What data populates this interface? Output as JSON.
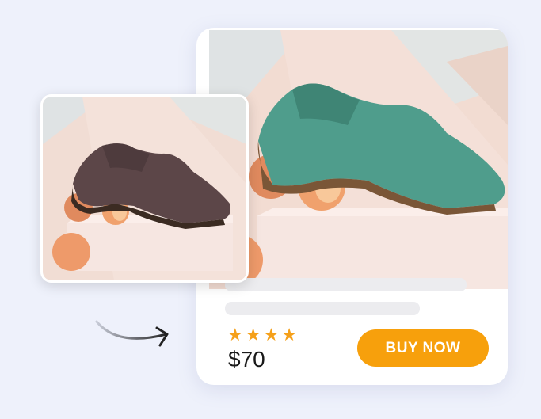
{
  "product": {
    "rating_stars": 4,
    "price": "$70",
    "buy_label": "BUY NOW"
  },
  "colors": {
    "accent": "#f7a00c",
    "star": "#f5a01a",
    "background": "#eef1fb"
  },
  "icons": {
    "arrow": "curved-arrow-icon",
    "star": "star-icon"
  }
}
